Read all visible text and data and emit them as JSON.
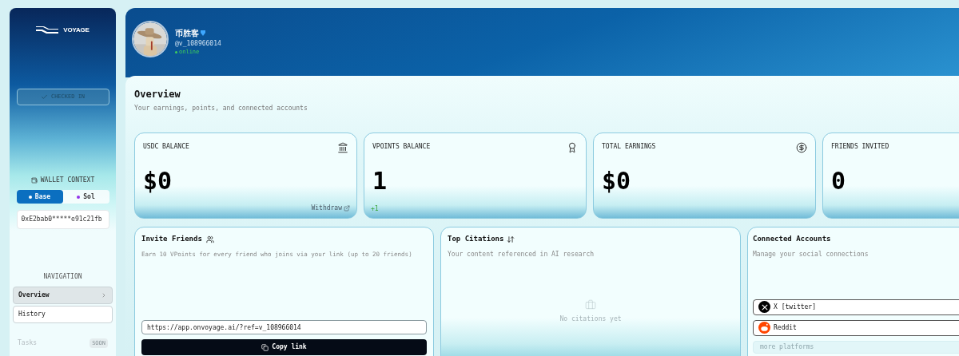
{
  "sidebar": {
    "logo_text": "VOYAGE",
    "check_in": {
      "label": "CHECKED IN",
      "checked": true
    },
    "wallet": {
      "label": "WALLET CONTEXT",
      "chains": [
        {
          "label": "Base",
          "selected": true,
          "color": "#ffffff"
        },
        {
          "label": "Sol",
          "selected": false,
          "color": "#9333ea"
        }
      ],
      "address": "0xE2bab0*****e91c21fb"
    },
    "navigation": {
      "label": "NAVIGATION",
      "items": [
        {
          "label": "Overview",
          "selected": true,
          "disabled": false
        },
        {
          "label": "History",
          "selected": false,
          "disabled": false
        },
        {
          "label": "Tasks",
          "selected": false,
          "disabled": true,
          "badge": "SOON"
        }
      ]
    }
  },
  "profile": {
    "name": "币胜客",
    "verified": true,
    "handle": "@v_108966014",
    "status": "online"
  },
  "overview": {
    "title": "Overview",
    "subtitle": "Your earnings, points, and connected accounts"
  },
  "stats": [
    {
      "label": "USDC BALANCE",
      "value": "$0",
      "footer": {
        "kind": "link",
        "text": "Withdraw"
      }
    },
    {
      "label": "VPOINTS BALANCE",
      "value": "1",
      "footer": {
        "kind": "delta",
        "text": "+1"
      }
    },
    {
      "label": "TOTAL EARNINGS",
      "value": "$0"
    },
    {
      "label": "FRIENDS INVITED",
      "value": "0"
    }
  ],
  "invite": {
    "title": "Invite Friends",
    "subtitle": "Earn 10 VPoints for every friend who joins via your link (up to 20 friends)",
    "link": "https://app.onvoyage.ai/?ref=v_108966014",
    "button": "Copy link"
  },
  "citations": {
    "title": "Top Citations",
    "subtitle": "Your content referenced in AI research",
    "empty": "No citations yet"
  },
  "accounts": {
    "title": "Connected Accounts",
    "subtitle": "Manage your social connections",
    "items": [
      {
        "kind": "x",
        "name": "X [twitter]"
      },
      {
        "kind": "reddit",
        "name": "Reddit"
      }
    ],
    "more": "more platforms"
  }
}
